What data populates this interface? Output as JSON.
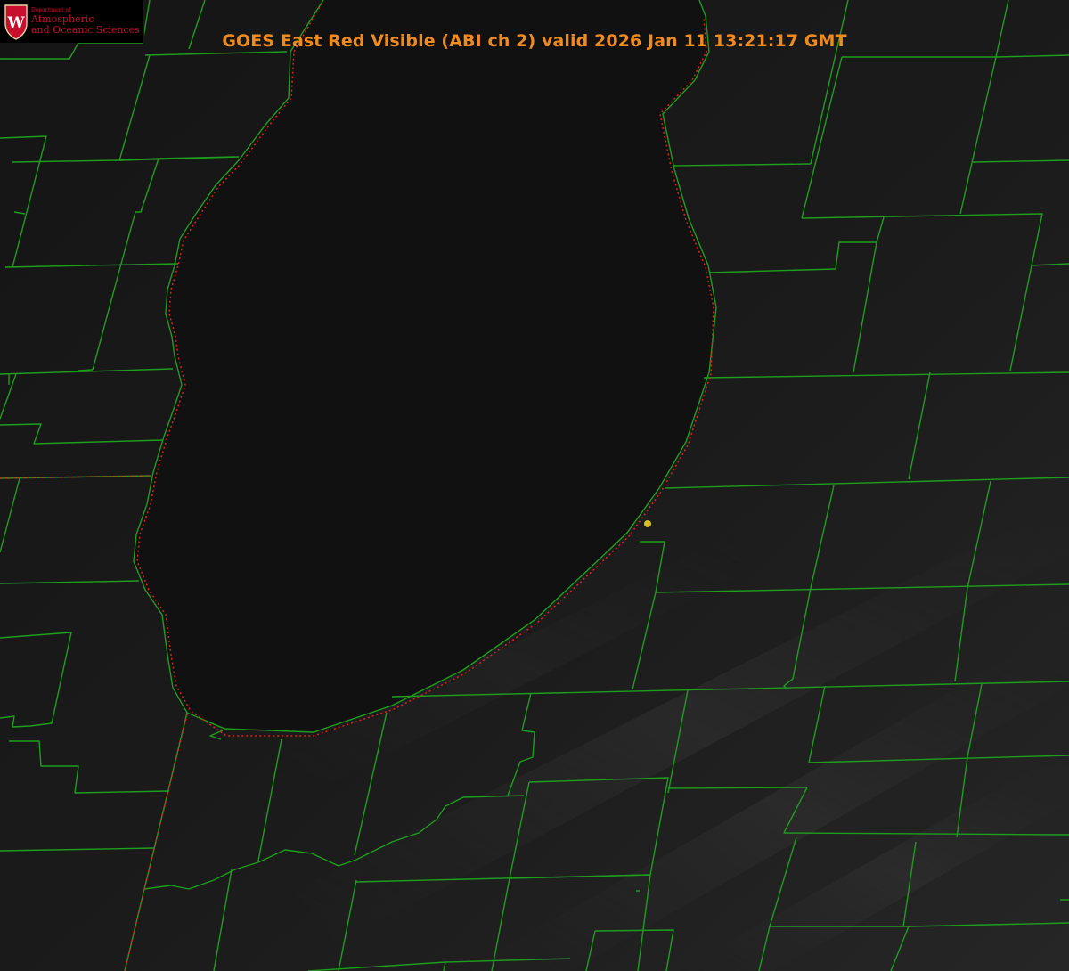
{
  "title": "GOES East Red Visible (ABI ch 2) valid 2026 Jan 11 13:21:17 GMT",
  "logo": {
    "icon": "uw-crest-icon",
    "crest_letter": "W",
    "department": "Department of",
    "line1": "Atmospheric",
    "line2": "and Oceanic Sciences"
  },
  "colors": {
    "background": "#141414",
    "lake": "#111111",
    "county_lines": "#1e9e1e",
    "state_lines": "#e02020",
    "title": "#ef8a1f",
    "marker": "#d8c020",
    "logo_red": "#c8102e"
  },
  "marker": {
    "icon": "location-dot-icon"
  }
}
